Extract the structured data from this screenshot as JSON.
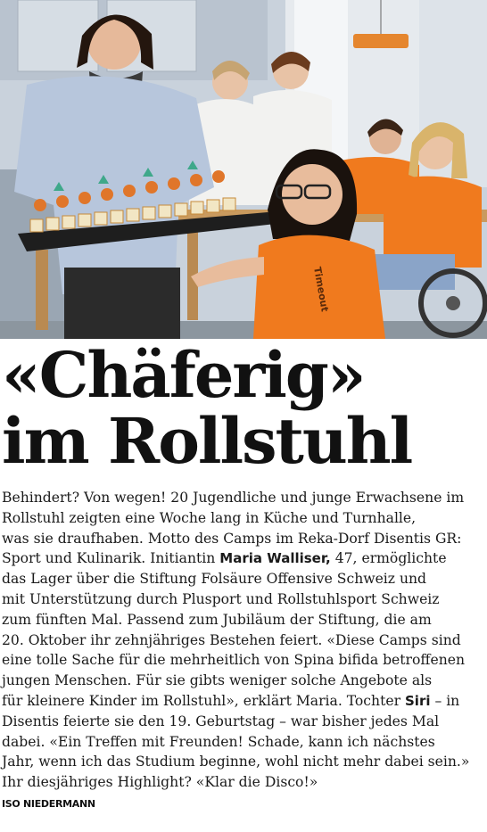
{
  "photo": {
    "shirt_print": "Timeout"
  },
  "headline": {
    "line1": "«Chäferig»",
    "line2": "im Rollstuhl"
  },
  "body": {
    "l1": "Behindert? Von wegen! 20 Jugendliche und junge Erwachsene im",
    "l2": "Rollstuhl zeigten eine Woche lang in Küche und Turnhalle,",
    "l3": "was sie draufhaben. Motto des Camps im Reka-Dorf Disentis GR:",
    "l4a": "Sport und Kulinarik. Initiantin ",
    "l4b": "Maria Walliser,",
    "l4c": " 47, ermöglichte",
    "l5": "das Lager über die Stiftung Folsäure Offensive Schweiz und",
    "l6": "mit Unterstützung durch Plusport und Rollstuhlsport Schweiz",
    "l7": "zum fünften Mal. Passend zum Jubiläum der Stiftung, die am",
    "l8": "20. Oktober ihr zehnjähriges Bestehen feiert. «Diese Camps sind",
    "l9": "eine tolle Sache für die mehrheitlich von Spina bifida betroffenen",
    "l10": "jungen Menschen. Für sie gibts weniger solche Angebote als",
    "l11a": "für kleinere Kinder im Rollstuhl», erklärt Maria. Tochter ",
    "l11b": "Siri",
    "l11c": " – in",
    "l12": "Disentis feierte sie den 19. Geburtstag – war bisher jedes Mal",
    "l13": "dabei. «Ein Treffen mit Freunden! Schade, kann ich nächstes",
    "l14": "Jahr, wenn ich das Studium beginne, wohl nicht mehr dabei sein.»",
    "l15": "Ihr diesjähriges Highlight? «Klar die Disco!»"
  },
  "credit": "ISO NIEDERMANN",
  "colors": {
    "text": "#141414",
    "orange_shirt": "#f07a1e",
    "chef_white": "#f2f2f0",
    "kitchen_wall": "#cfd7e0"
  }
}
